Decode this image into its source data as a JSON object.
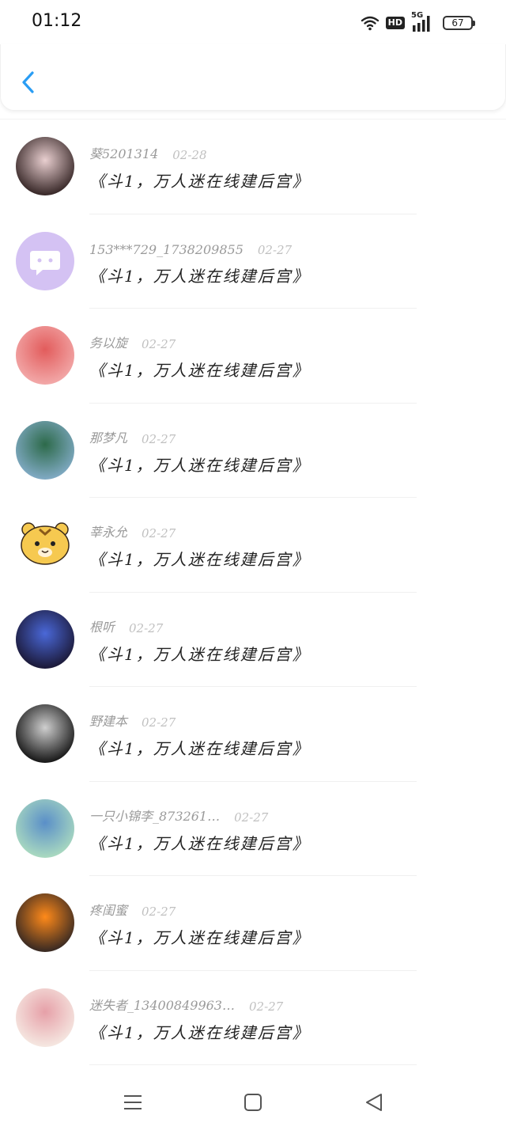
{
  "status_bar": {
    "time": "01:12",
    "hd_label": "HD",
    "network_label": "5G",
    "battery_level": "67"
  },
  "colors": {
    "accent": "#2a9df4",
    "text_primary": "#222222",
    "text_secondary": "#9a9a9a",
    "text_muted": "#c0c0c0"
  },
  "header": {
    "back_icon": "chevron-left-icon"
  },
  "messages": [
    {
      "name": "葵5201314",
      "date": "02-28",
      "text": "《斗1，万人迷在线建后宫》",
      "avatar": "avatar-girl-bear-ears",
      "avatar_colors": [
        "#3a2a2a",
        "#e9cfd0"
      ]
    },
    {
      "name": "153***729_1738209855",
      "date": "02-27",
      "text": "《斗1，万人迷在线建后宫》",
      "avatar": "avatar-default-chat",
      "avatar_colors": [
        "#d4c2f3",
        "#ffffff"
      ]
    },
    {
      "name": "务以旋",
      "date": "02-27",
      "text": "《斗1，万人迷在线建后宫》",
      "avatar": "avatar-anime-girl-roses",
      "avatar_colors": [
        "#f2a7a7",
        "#e25c5c"
      ]
    },
    {
      "name": "那梦凡",
      "date": "02-27",
      "text": "《斗1，万人迷在线建后宫》",
      "avatar": "avatar-green-car",
      "avatar_colors": [
        "#7fa9c2",
        "#2d6a4a"
      ]
    },
    {
      "name": "莘永允",
      "date": "02-27",
      "text": "《斗1，万人迷在线建后宫》",
      "avatar": "avatar-tiger-cartoon",
      "avatar_colors": [
        "#f6c950",
        "#8a5a1a"
      ]
    },
    {
      "name": "根听",
      "date": "02-27",
      "text": "《斗1，万人迷在线建后宫》",
      "avatar": "avatar-dark-anime-girl",
      "avatar_colors": [
        "#1c1a3a",
        "#4a68d8"
      ]
    },
    {
      "name": "野建本",
      "date": "02-27",
      "text": "《斗1，万人迷在线建后宫》",
      "avatar": "avatar-silver-hair-ninja",
      "avatar_colors": [
        "#1a1a1a",
        "#cfcfcf"
      ]
    },
    {
      "name": "一只小锦李_873261…",
      "date": "02-27",
      "text": "《斗1，万人迷在线建后宫》",
      "avatar": "avatar-blue-hair-boy",
      "avatar_colors": [
        "#a8d8c0",
        "#5a8fc8"
      ]
    },
    {
      "name": "疼闺蜜",
      "date": "02-27",
      "text": "《斗1，万人迷在线建后宫》",
      "avatar": "avatar-orange-glow",
      "avatar_colors": [
        "#3a2a22",
        "#ff8a1a"
      ]
    },
    {
      "name": "迷失者_13400849963…",
      "date": "02-27",
      "text": "《斗1，万人迷在线建后宫》",
      "avatar": "avatar-flower-girl",
      "avatar_colors": [
        "#f5e6e0",
        "#e6a0a8"
      ]
    }
  ],
  "nav_bar": {
    "menu_icon": "menu-icon",
    "home_icon": "home-square-icon",
    "back_icon": "back-triangle-icon"
  }
}
